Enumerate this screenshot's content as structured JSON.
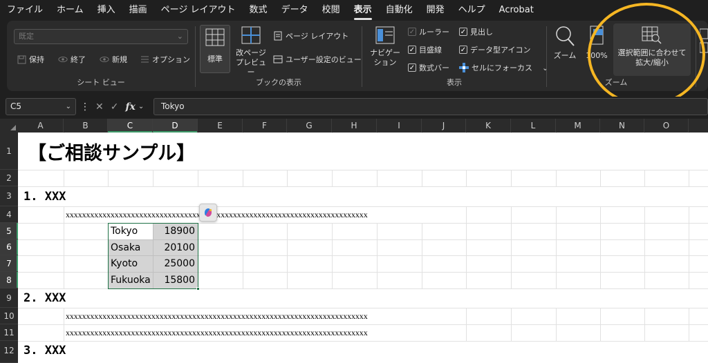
{
  "menu": {
    "items": [
      "ファイル",
      "ホーム",
      "挿入",
      "描画",
      "ページ レイアウト",
      "数式",
      "データ",
      "校閲",
      "表示",
      "自動化",
      "開発",
      "ヘルプ",
      "Acrobat"
    ],
    "active_index": 8
  },
  "ribbon": {
    "sheet_view": {
      "label": "シート ビュー",
      "select_value": "既定",
      "keep": "保持",
      "exit": "終了",
      "new": "新規",
      "options": "オプション"
    },
    "workbook_views": {
      "label": "ブックの表示",
      "normal": "標準",
      "page_break_line1": "改ページ",
      "page_break_line2": "プレビュー",
      "page_layout": "ページ レイアウト",
      "custom_views": "ユーザー設定のビュー"
    },
    "show": {
      "label": "表示",
      "navigation_line1": "ナビゲー",
      "navigation_line2": "ション",
      "ruler": "ルーラー",
      "gridlines": "目盛線",
      "formula_bar": "数式バー",
      "headings": "見出し",
      "data_type_icons": "データ型アイコン",
      "focus_cell": "セルにフォーカス"
    },
    "zoom": {
      "label": "ズーム",
      "zoom": "ズーム",
      "hundred": "100%",
      "zoom_to_selection_line1": "選択範囲に合わせて",
      "zoom_to_selection_line2": "拡大/縮小"
    }
  },
  "formula_bar": {
    "name_box": "C5",
    "fx": "fx",
    "value": "Tokyo"
  },
  "sheet": {
    "columns": [
      "A",
      "B",
      "C",
      "D",
      "E",
      "F",
      "G",
      "H",
      "I",
      "J",
      "K",
      "L",
      "M",
      "N",
      "O"
    ],
    "rows": [
      "1",
      "2",
      "3",
      "4",
      "5",
      "6",
      "7",
      "8",
      "9",
      "10",
      "11",
      "12"
    ],
    "title": "【ご相談サンプル】",
    "heading1": "1. XXX",
    "heading2": "2. XXX",
    "heading3": "3. XXX",
    "xx_row4": "xxxxxxxxxxxxxxxxxxxxxxxxxxxxxxxxxxxxxxxxxxxxxxxxxxxxxxxxxxxxxxxxxxxxxxxxxx",
    "xx_row10": "xxxxxxxxxxxxxxxxxxxxxxxxxxxxxxxxxxxxxxxxxxxxxxxxxxxxxxxxxxxxxxxxxxxxxxxxxx",
    "xx_row11": "xxxxxxxxxxxxxxxxxxxxxxxxxxxxxxxxxxxxxxxxxxxxxxxxxxxxxxxxxxxxxxxxxxxxxxxxxx",
    "table": [
      {
        "name": "Tokyo",
        "value": "18900"
      },
      {
        "name": "Osaka",
        "value": "20100"
      },
      {
        "name": "Kyoto",
        "value": "25000"
      },
      {
        "name": "Fukuoka",
        "value": "15800"
      }
    ]
  },
  "colors": {
    "accent_green": "#1e7145",
    "highlight": "#f5b623"
  }
}
